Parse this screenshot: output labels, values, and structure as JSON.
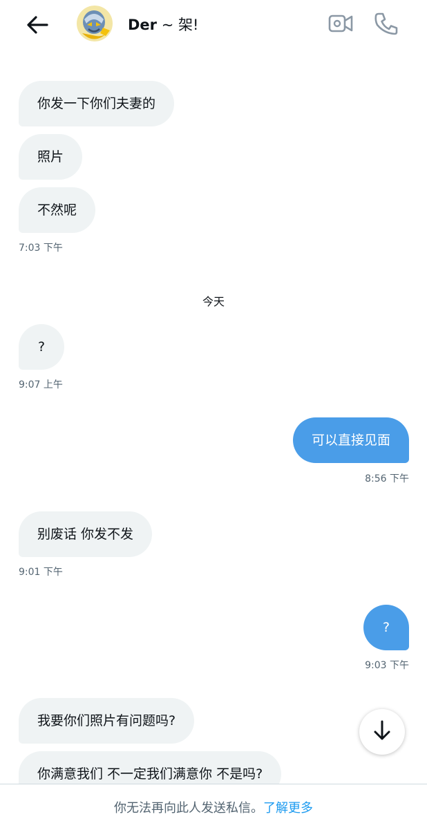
{
  "header": {
    "contact_name": "Der",
    "contact_suffix": " ~ 架!",
    "icons": {
      "back": "arrow-left-icon",
      "video": "video-camera-icon",
      "phone": "phone-icon"
    }
  },
  "messages": [
    {
      "text": "你发一下你们夫妻的",
      "direction": "incoming"
    },
    {
      "text": "照片",
      "direction": "incoming"
    },
    {
      "text": "不然呢",
      "direction": "incoming"
    },
    {
      "timestamp": "7:03 下午"
    },
    {
      "divider": "今天"
    },
    {
      "text": "?",
      "direction": "incoming"
    },
    {
      "timestamp": "9:07 上午"
    },
    {
      "text": "可以直接见面",
      "direction": "outgoing"
    },
    {
      "timestamp": "8:56 下午"
    },
    {
      "text": "别废话 你发不发",
      "direction": "incoming"
    },
    {
      "timestamp": "9:01 下午"
    },
    {
      "text": "?",
      "direction": "outgoing"
    },
    {
      "timestamp": "9:03 下午"
    },
    {
      "text": "我要你们照片有问题吗?",
      "direction": "incoming"
    },
    {
      "text": "你满意我们 不一定我们满意你 不是吗?",
      "direction": "incoming"
    }
  ],
  "scroll_button": {
    "icon": "arrow-down-icon"
  },
  "footer": {
    "notice": "你无法再向此人发送私信。",
    "link": "了解更多"
  },
  "colors": {
    "outgoing_bubble": "#4a9de8",
    "incoming_bubble": "#eff3f4",
    "link": "#1d9bf0"
  }
}
